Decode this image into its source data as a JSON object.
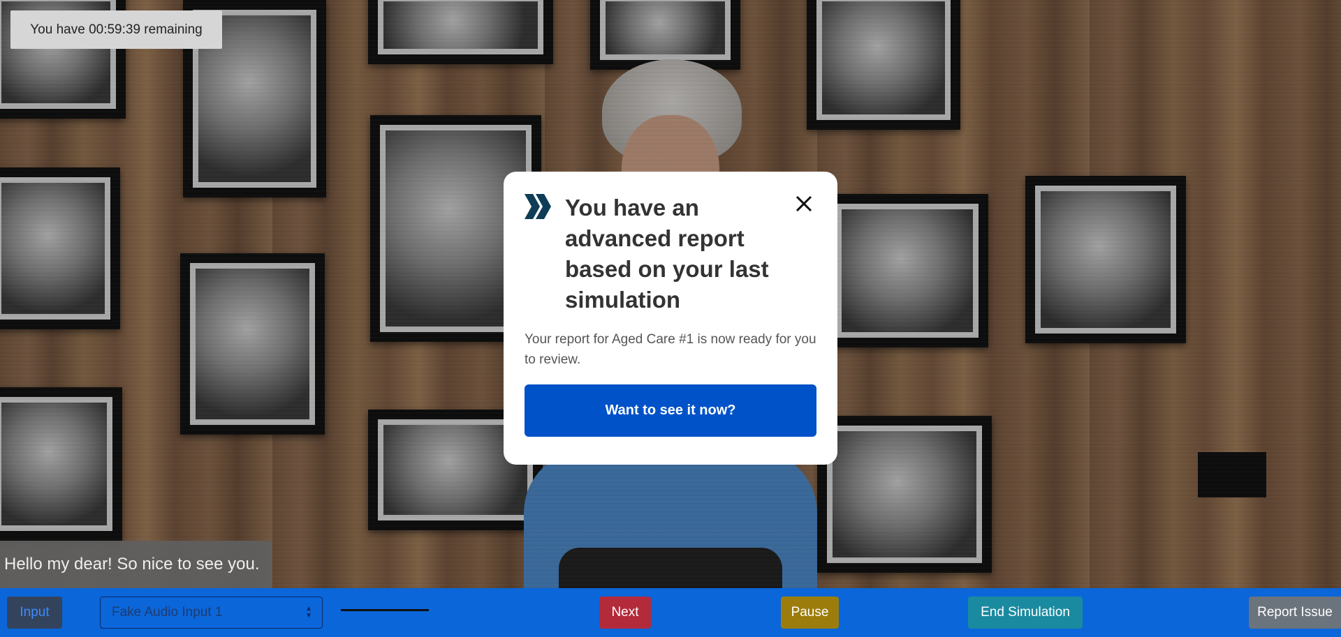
{
  "timer": {
    "text": "You have 00:59:39 remaining"
  },
  "speech": {
    "text": "Hello my dear! So nice to see you."
  },
  "modal": {
    "title": "You have an advanced report based on your last simulation",
    "body": "Your report for Aged Care #1 is now ready for you to review.",
    "cta": "Want to see it now?",
    "close_icon": "close-icon",
    "logo_icon": "chevron-logo-icon",
    "cta_color": "#0052c9",
    "logo_color": "#0f3d57"
  },
  "toolbar": {
    "input_label": "Input",
    "audio_select_value": "Fake Audio Input 1",
    "next_label": "Next",
    "pause_label": "Pause",
    "end_label": "End Simulation",
    "report_label": "Report Issue",
    "bar_color": "#0b66d9"
  }
}
